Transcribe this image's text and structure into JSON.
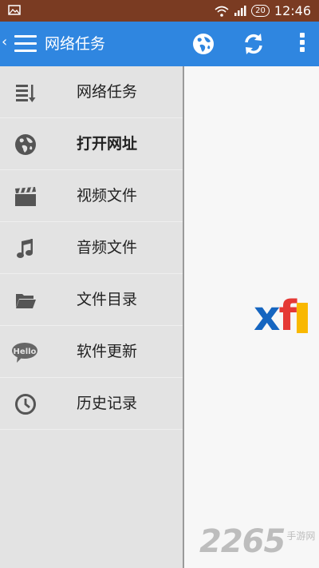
{
  "status_bar": {
    "left_icon": "image-icon",
    "badge": "20",
    "time": "12:46"
  },
  "app_bar": {
    "back_glyph": "‹",
    "title": "网络任务",
    "actions": [
      "globe-icon",
      "refresh-icon",
      "more-vert-icon"
    ],
    "color": "#2f86e0"
  },
  "drawer": {
    "items": [
      {
        "label": "网络任务",
        "icon": "download-list-icon"
      },
      {
        "label": "打开网址",
        "icon": "globe-icon"
      },
      {
        "label": "视频文件",
        "icon": "clapperboard-icon"
      },
      {
        "label": "音频文件",
        "icon": "music-note-icon"
      },
      {
        "label": "文件目录",
        "icon": "folder-icon"
      },
      {
        "label": "软件更新",
        "icon": "hello-bubble-icon"
      },
      {
        "label": "历史记录",
        "icon": "clock-icon"
      }
    ],
    "active_index": 1
  },
  "content": {
    "logo_text": [
      "x",
      "f"
    ]
  },
  "watermark": {
    "number": "2265",
    "suffix": "手游网"
  }
}
